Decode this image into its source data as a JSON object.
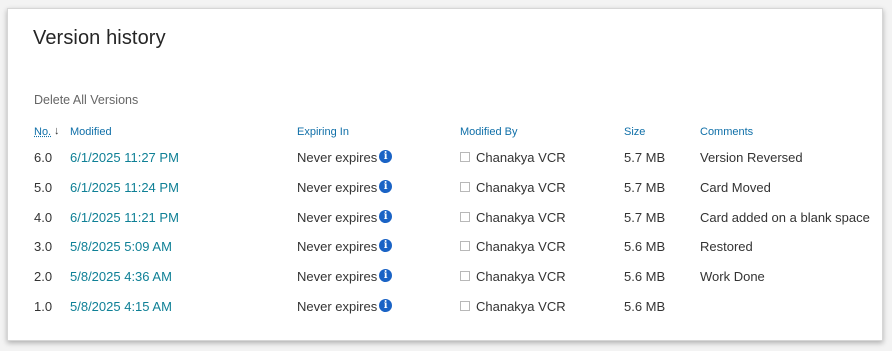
{
  "title": "Version history",
  "delete_all_label": "Delete All Versions",
  "columns": {
    "no": "No.",
    "modified": "Modified",
    "expiring_in": "Expiring In",
    "modified_by": "Modified By",
    "size": "Size",
    "comments": "Comments"
  },
  "sort_indicator": "↓",
  "info_glyph": "i",
  "rows": [
    {
      "no": "6.0",
      "modified": "6/1/2025 11:27 PM",
      "expiring": "Never expires",
      "by": "Chanakya VCR",
      "size": "5.7 MB",
      "comment": "Version Reversed"
    },
    {
      "no": "5.0",
      "modified": "6/1/2025 11:24 PM",
      "expiring": "Never expires",
      "by": "Chanakya VCR",
      "size": "5.7 MB",
      "comment": "Card Moved"
    },
    {
      "no": "4.0",
      "modified": "6/1/2025 11:21 PM",
      "expiring": "Never expires",
      "by": "Chanakya VCR",
      "size": "5.7 MB",
      "comment": "Card added on a blank space"
    },
    {
      "no": "3.0",
      "modified": "5/8/2025 5:09 AM",
      "expiring": "Never expires",
      "by": "Chanakya VCR",
      "size": "5.6 MB",
      "comment": "Restored"
    },
    {
      "no": "2.0",
      "modified": "5/8/2025 4:36 AM",
      "expiring": "Never expires",
      "by": "Chanakya VCR",
      "size": "5.6 MB",
      "comment": "Work Done"
    },
    {
      "no": "1.0",
      "modified": "5/8/2025 4:15 AM",
      "expiring": "Never expires",
      "by": "Chanakya VCR",
      "size": "5.6 MB",
      "comment": ""
    }
  ],
  "colors": {
    "link": "#0f8096",
    "header": "#0f6fa8",
    "info": "#1a63c5"
  }
}
